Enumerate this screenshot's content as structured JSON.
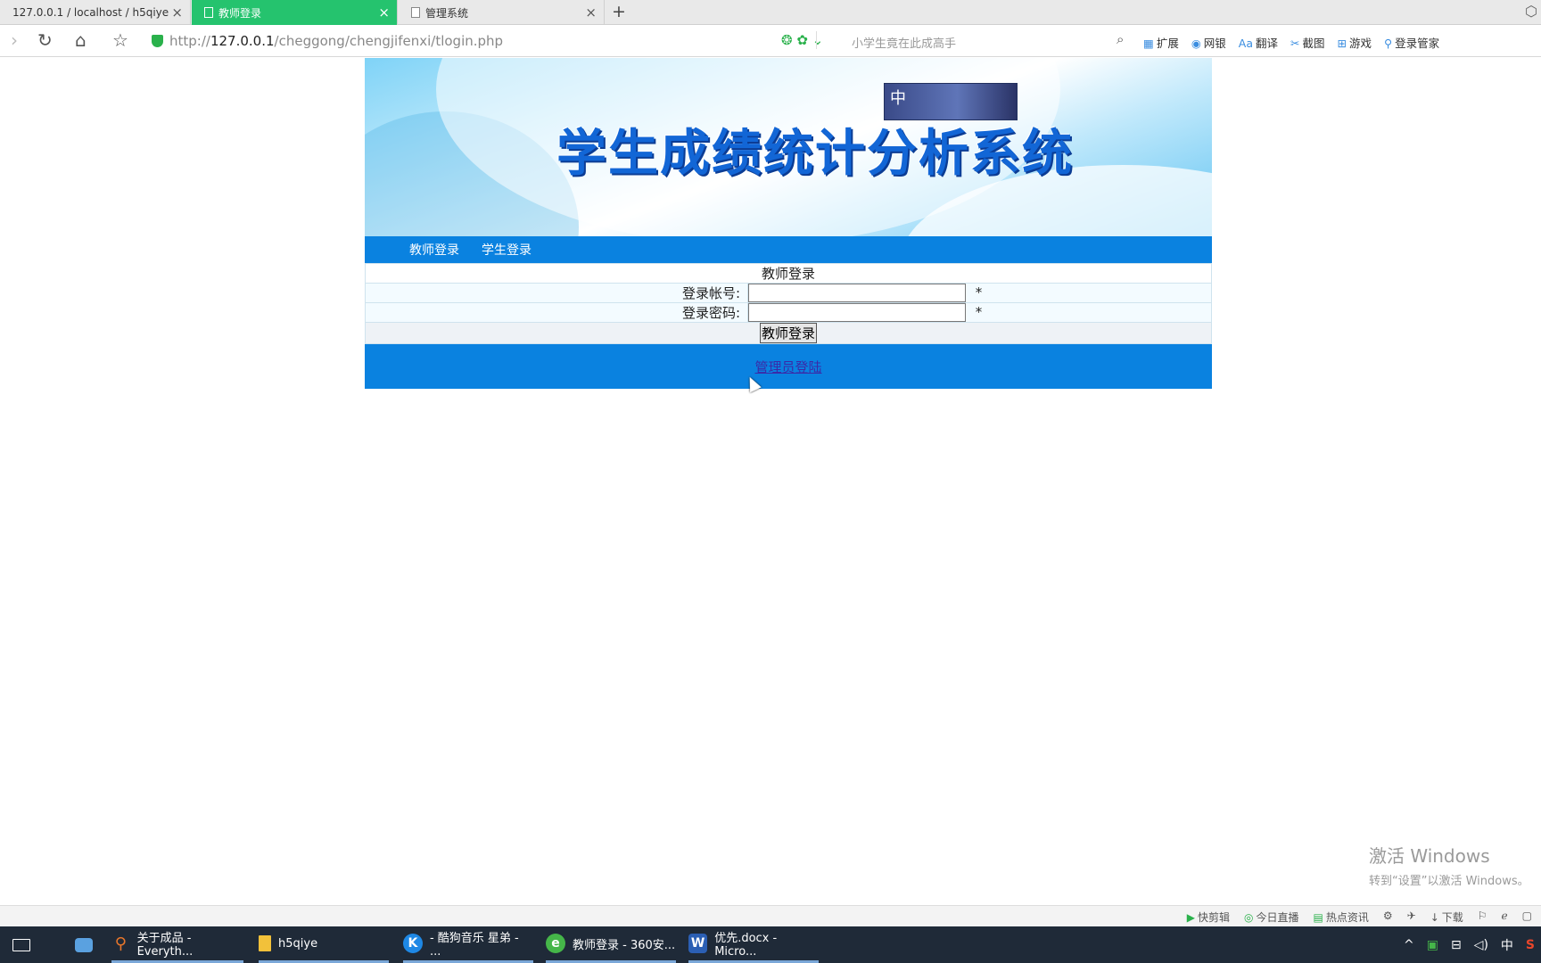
{
  "browser": {
    "tabs": [
      {
        "label": "127.0.0.1 / localhost / h5qiye",
        "active": false
      },
      {
        "label": "教师登录",
        "active": true
      },
      {
        "label": "管理系统",
        "active": false
      }
    ],
    "new_tab": "+",
    "url_prefix": "http://",
    "url_host": "127.0.0.1",
    "url_path": "/cheggong/chengjifenxi/tlogin.php",
    "search_placeholder": "小学生竟在此成高手",
    "tools": [
      "扩展",
      "网银",
      "翻译",
      "截图",
      "游戏",
      "登录管家"
    ]
  },
  "page": {
    "banner_title": "学生成绩统计分析系统",
    "banner_badge": "中",
    "nav": [
      "教师登录",
      "学生登录"
    ],
    "form": {
      "caption": "教师登录",
      "account_label": "登录帐号:",
      "password_label": "登录密码:",
      "required_mark": "*",
      "account_value": "",
      "password_value": "",
      "submit_label": "教师登录"
    },
    "admin_link": "管理员登陆"
  },
  "watermark": {
    "line1": "激活 Windows",
    "line2": "转到“设置”以激活 Windows。"
  },
  "statusbar": [
    "快剪辑",
    "今日直播",
    "热点资讯",
    "下载"
  ],
  "taskbar": {
    "items": [
      {
        "label": "关于成品 - Everyth...",
        "icon_color": "#e8762b"
      },
      {
        "label": "h5qiye",
        "icon_color": "#f2c13a"
      },
      {
        "label": "- 酷狗音乐 星弟 - ...",
        "icon_color": "#1e88e5"
      },
      {
        "label": "教师登录 - 360安...",
        "icon_color": "#45b649"
      },
      {
        "label": "优先.docx - Micro...",
        "icon_color": "#2b5fb4"
      }
    ],
    "tray_ime": "中"
  }
}
